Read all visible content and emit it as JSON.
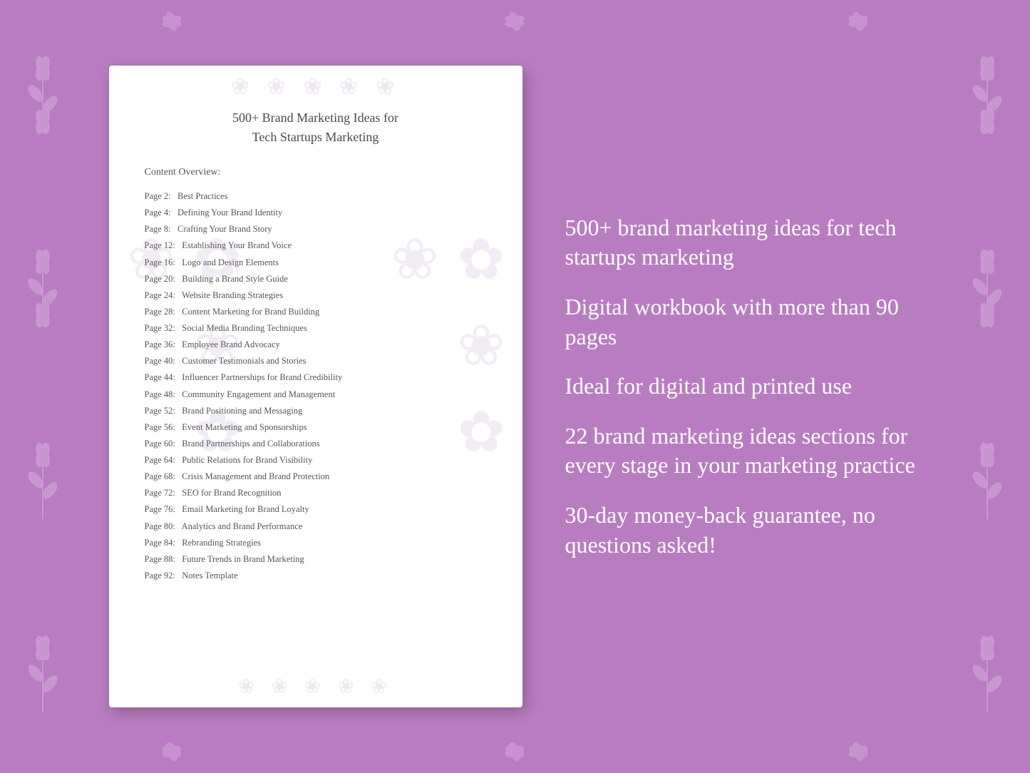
{
  "background": {
    "color": "#b87dc0"
  },
  "document": {
    "title_line1": "500+ Brand Marketing Ideas for",
    "title_line2": "Tech Startups Marketing",
    "toc_header": "Content Overview:",
    "toc_items": [
      {
        "page": "Page  2:",
        "title": "Best Practices"
      },
      {
        "page": "Page  4:",
        "title": "Defining Your Brand Identity"
      },
      {
        "page": "Page  8:",
        "title": "Crafting Your Brand Story"
      },
      {
        "page": "Page 12:",
        "title": "Establishing Your Brand Voice"
      },
      {
        "page": "Page 16:",
        "title": "Logo and Design Elements"
      },
      {
        "page": "Page 20:",
        "title": "Building a Brand Style Guide"
      },
      {
        "page": "Page 24:",
        "title": "Website Branding Strategies"
      },
      {
        "page": "Page 28:",
        "title": "Content Marketing for Brand Building"
      },
      {
        "page": "Page 32:",
        "title": "Social Media Branding Techniques"
      },
      {
        "page": "Page 36:",
        "title": "Employee Brand Advocacy"
      },
      {
        "page": "Page 40:",
        "title": "Customer Testimonials and Stories"
      },
      {
        "page": "Page 44:",
        "title": "Influencer Partnerships for Brand Credibility"
      },
      {
        "page": "Page 48:",
        "title": "Community Engagement and Management"
      },
      {
        "page": "Page 52:",
        "title": "Brand Positioning and Messaging"
      },
      {
        "page": "Page 56:",
        "title": "Event Marketing and Sponsorships"
      },
      {
        "page": "Page 60:",
        "title": "Brand Partnerships and Collaborations"
      },
      {
        "page": "Page 64:",
        "title": "Public Relations for Brand Visibility"
      },
      {
        "page": "Page 68:",
        "title": "Crisis Management and Brand Protection"
      },
      {
        "page": "Page 72:",
        "title": "SEO for Brand Recognition"
      },
      {
        "page": "Page 76:",
        "title": "Email Marketing for Brand Loyalty"
      },
      {
        "page": "Page 80:",
        "title": "Analytics and Brand Performance"
      },
      {
        "page": "Page 84:",
        "title": "Rebranding Strategies"
      },
      {
        "page": "Page 88:",
        "title": "Future Trends in Brand Marketing"
      },
      {
        "page": "Page 92:",
        "title": "Notes Template"
      }
    ]
  },
  "features": [
    {
      "id": "feature1",
      "text": "500+ brand marketing ideas for tech startups marketing"
    },
    {
      "id": "feature2",
      "text": "Digital workbook with more than 90 pages"
    },
    {
      "id": "feature3",
      "text": "Ideal for digital and printed use"
    },
    {
      "id": "feature4",
      "text": "22 brand marketing ideas sections for every stage in your marketing practice"
    },
    {
      "id": "feature5",
      "text": "30-day money-back guarantee, no questions asked!"
    }
  ]
}
